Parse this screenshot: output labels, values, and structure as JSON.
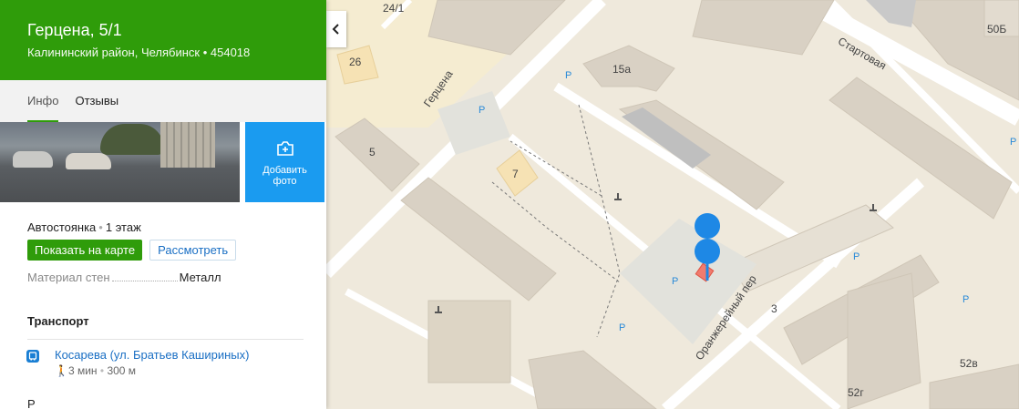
{
  "place": {
    "title": "Герцена, 5/1",
    "address": "Калининский район, Челябинск • 454018"
  },
  "tabs": [
    {
      "label": "Инфо",
      "active": true
    },
    {
      "label": "Отзывы",
      "active": false
    }
  ],
  "photo_button": {
    "line1": "Добавить",
    "line2": "фото"
  },
  "info": {
    "category": "Автостоянка",
    "floors": "1 этаж",
    "show_on_map": "Показать на карте",
    "view": "Рассмотреть",
    "wall_material_label": "Материал стен",
    "wall_material_value": "Металл"
  },
  "transport": {
    "heading": "Транспорт",
    "stop_name": "Косарева (ул. Братьев Кашириных)",
    "walk_time": "3 мин",
    "distance": "300 м",
    "next_heading_partial": "Р"
  },
  "map": {
    "streets": {
      "gertsena": "Герцена",
      "startovaya": "Стартовая",
      "oranzhereyny": "Оранжерейный пер"
    },
    "house_numbers": [
      "24/1",
      "26",
      "5",
      "7",
      "15а",
      "3",
      "50Б",
      "52в",
      "52г"
    ],
    "parking_letter": "P",
    "marker_color": "#1e88e5",
    "accent_green": "#2f9c0a"
  }
}
